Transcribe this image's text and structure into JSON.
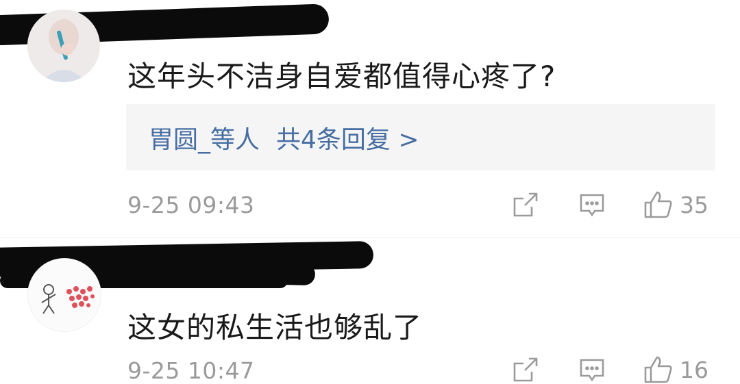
{
  "comments": [
    {
      "text": "这年头不洁身自爱都值得心疼了?",
      "replies": {
        "names": "胃圆_等人",
        "count": "共4条回复 >"
      },
      "time": "9-25 09:43",
      "likes": "35",
      "icons": {
        "share": "share-icon",
        "reply": "comment-icon",
        "like": "thumbs-up-icon"
      }
    },
    {
      "text": "这女的私生活也够乱了",
      "time": "9-25 10:47",
      "likes": "16",
      "icons": {
        "share": "share-icon",
        "reply": "comment-icon",
        "like": "thumbs-up-icon"
      }
    }
  ],
  "colors": {
    "reply_link": "#476ea3",
    "meta": "#9a9a9a",
    "redaction": "#0b0b0b"
  }
}
